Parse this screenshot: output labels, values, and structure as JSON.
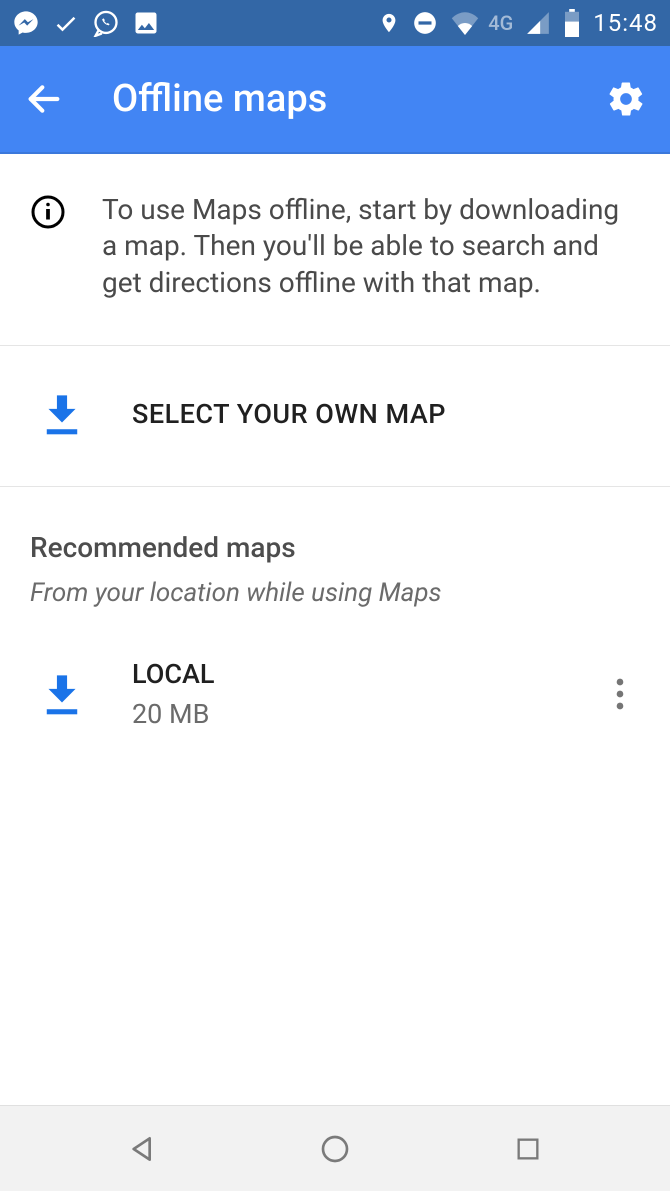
{
  "status_bar": {
    "network_label": "4G",
    "clock": "15:48"
  },
  "app_bar": {
    "title": "Offline maps"
  },
  "info": {
    "text": "To use Maps offline, start by downloading a map. Then you'll be able to search and get directions offline with that map."
  },
  "select_own": {
    "label": "SELECT YOUR OWN MAP"
  },
  "recommended": {
    "heading": "Recommended maps",
    "subheading": "From your location while using Maps",
    "items": [
      {
        "title": "LOCAL",
        "size": "20 MB"
      }
    ]
  },
  "colors": {
    "status_bar_bg": "#3367a6",
    "app_bar_bg": "#4285f4",
    "accent_blue": "#1a73e8"
  }
}
